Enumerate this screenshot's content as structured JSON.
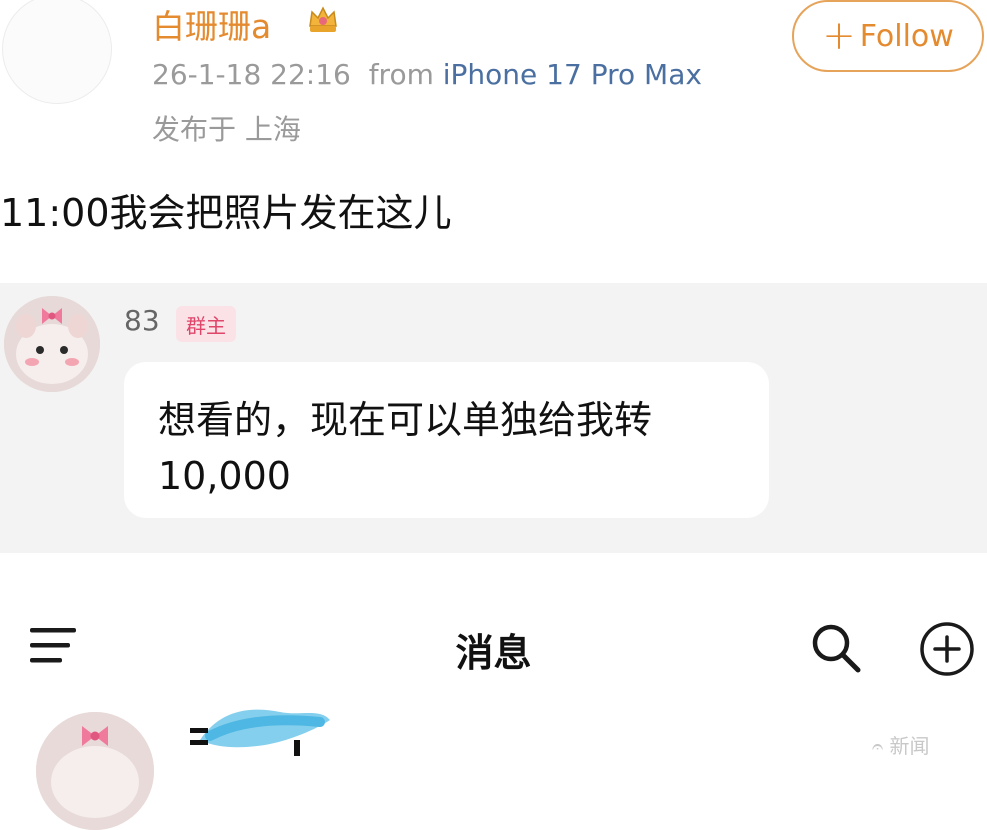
{
  "post": {
    "username": "白珊珊a",
    "badge_icon": "crown-icon",
    "timestamp": "26-1-18 22:16",
    "from_label": "from",
    "device": "iPhone 17 Pro Max",
    "location": "发布于 上海",
    "follow_label": "Follow",
    "text": "11:00我会把照片发在这儿"
  },
  "group_chat": {
    "sender": "83",
    "role_badge": "群主",
    "message_line1": "想看的，现在可以单独给我转",
    "message_line2": "10,000"
  },
  "messages_screen": {
    "title": "消息",
    "icons": [
      "menu-icon",
      "search-icon",
      "add-icon"
    ]
  },
  "watermark": "𝄐 新闻"
}
